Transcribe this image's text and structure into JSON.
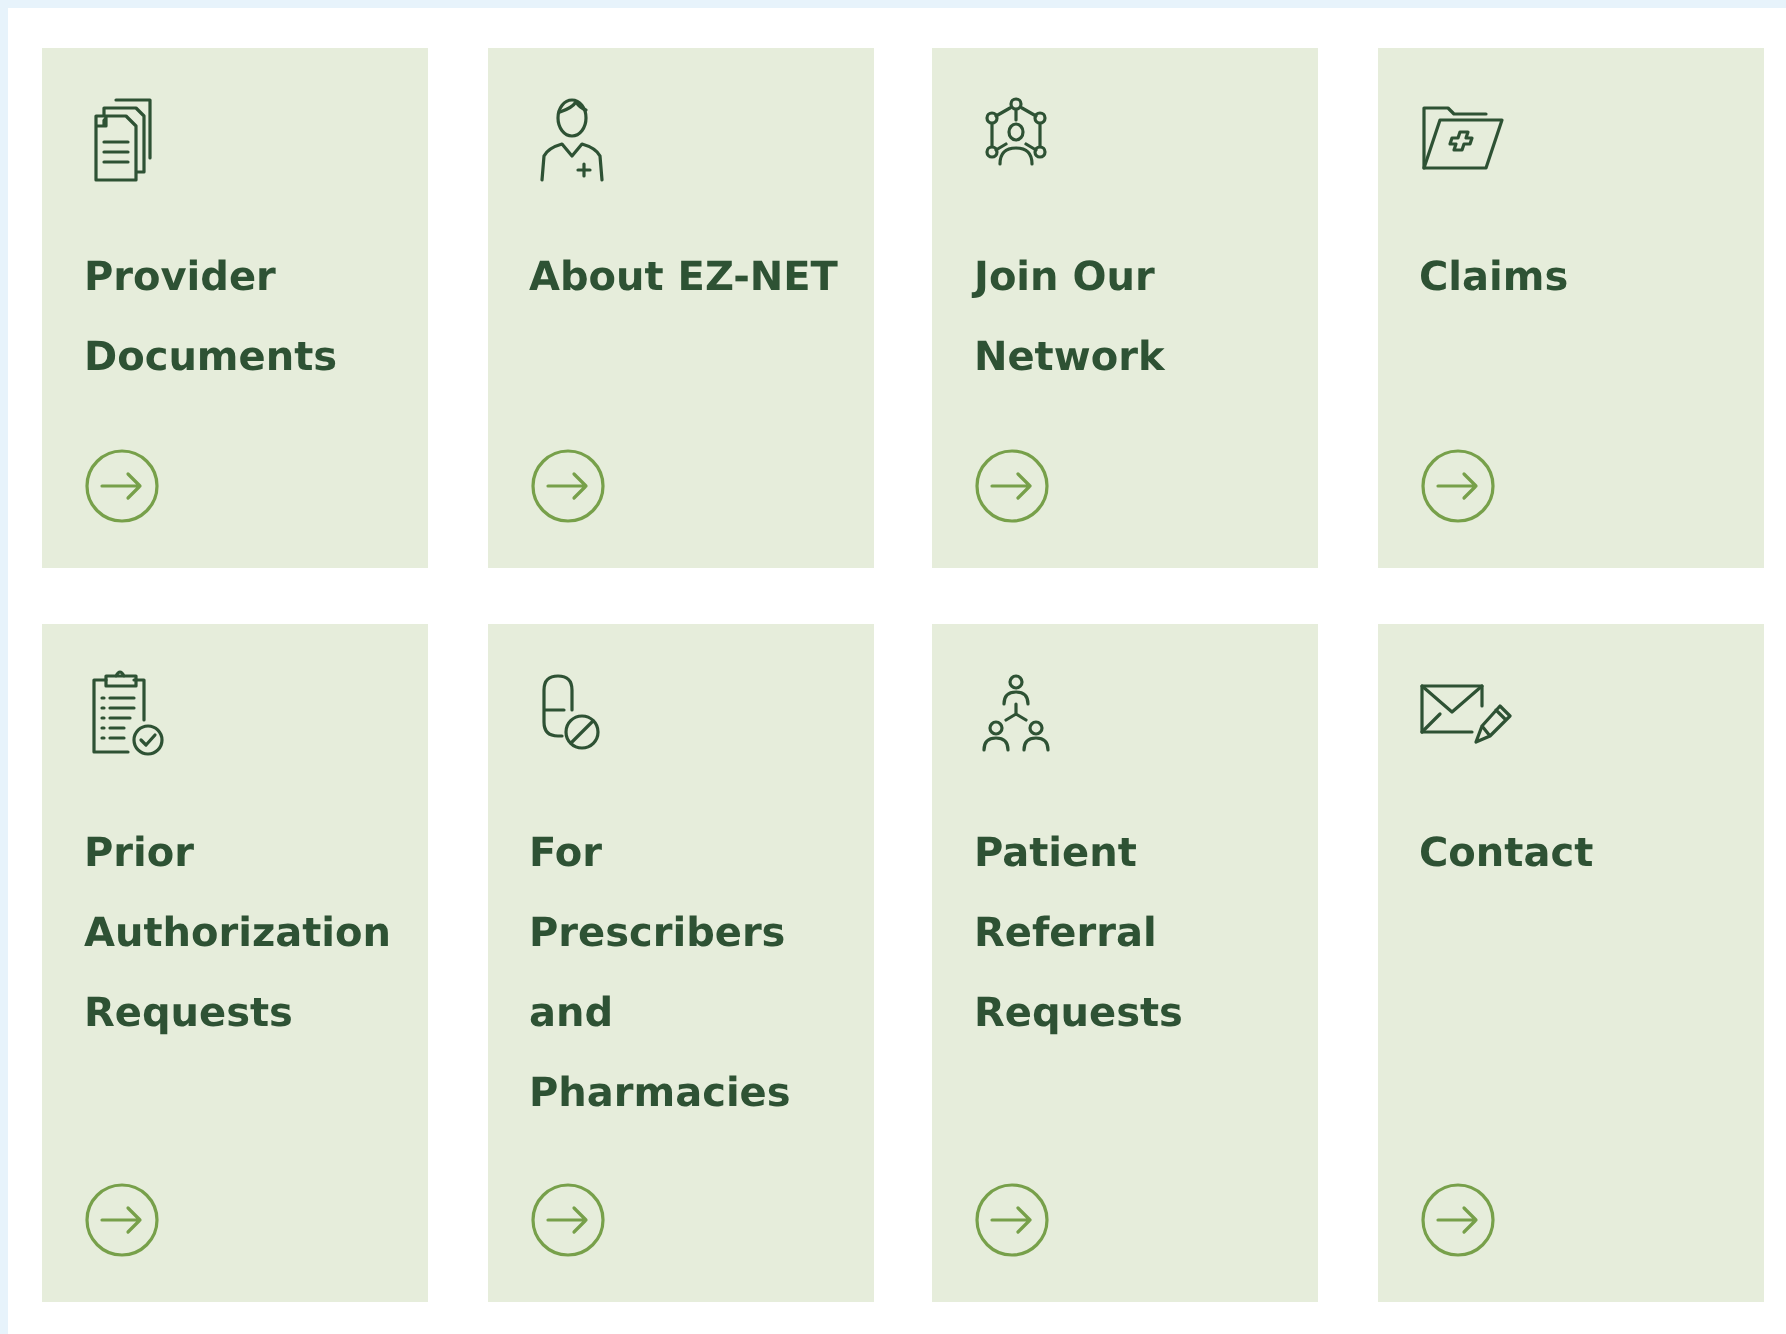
{
  "cards": [
    {
      "title": "Provider Documents"
    },
    {
      "title": "About EZ-NET"
    },
    {
      "title": "Join Our Network"
    },
    {
      "title": "Claims"
    },
    {
      "title": "Prior Authorization Requests"
    },
    {
      "title": "For Prescribers and Pharmacies"
    },
    {
      "title": "Patient Referral Requests"
    },
    {
      "title": "Contact"
    }
  ]
}
